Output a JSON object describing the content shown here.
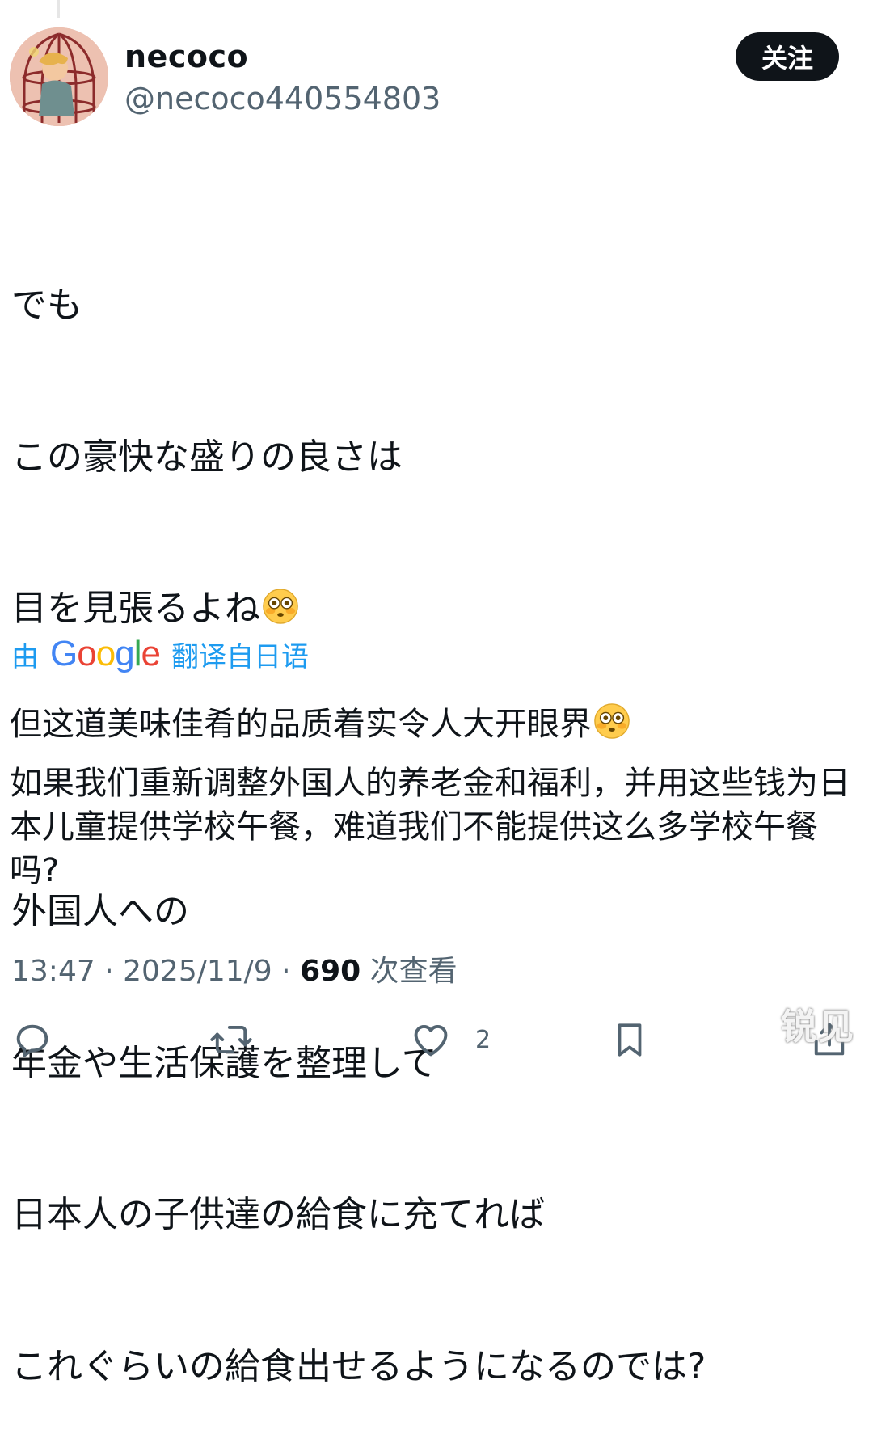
{
  "author": {
    "display_name": "necoco",
    "handle": "@necoco440554803"
  },
  "follow_label": "关注",
  "original_text": {
    "lines": [
      "でも",
      "この豪快な盛りの良さは",
      "目を見張るよね",
      "",
      "外国人への",
      "年金や生活保護を整理して",
      "日本人の子供達の給食に充てれば",
      "これぐらいの給食出せるようになるのでは?"
    ],
    "emoji": "flushed-face"
  },
  "translation": {
    "prefix": "由",
    "brand": "Google",
    "suffix": "翻译自日语",
    "first_line": "但这道美味佳肴的品质着实令人大开眼界",
    "paragraph": "如果我们重新调整外国人的养老金和福利，并用这些钱为日本儿童提供学校午餐，难道我们不能提供这么多学校午餐吗?"
  },
  "meta": {
    "time": "13:47",
    "separator": "·",
    "date": "2025/11/9",
    "views_count": "690",
    "views_label": "次查看"
  },
  "actions": {
    "reply_icon": "reply-icon",
    "repost_icon": "repost-icon",
    "like_icon": "like-icon",
    "like_count": "2",
    "bookmark_icon": "bookmark-icon",
    "share_icon": "share-icon"
  },
  "watermark": "锐见",
  "colors": {
    "text_primary": "#0f1419",
    "text_secondary": "#536471",
    "link_blue": "#1d9bf0",
    "follow_bg": "#0f1419"
  }
}
